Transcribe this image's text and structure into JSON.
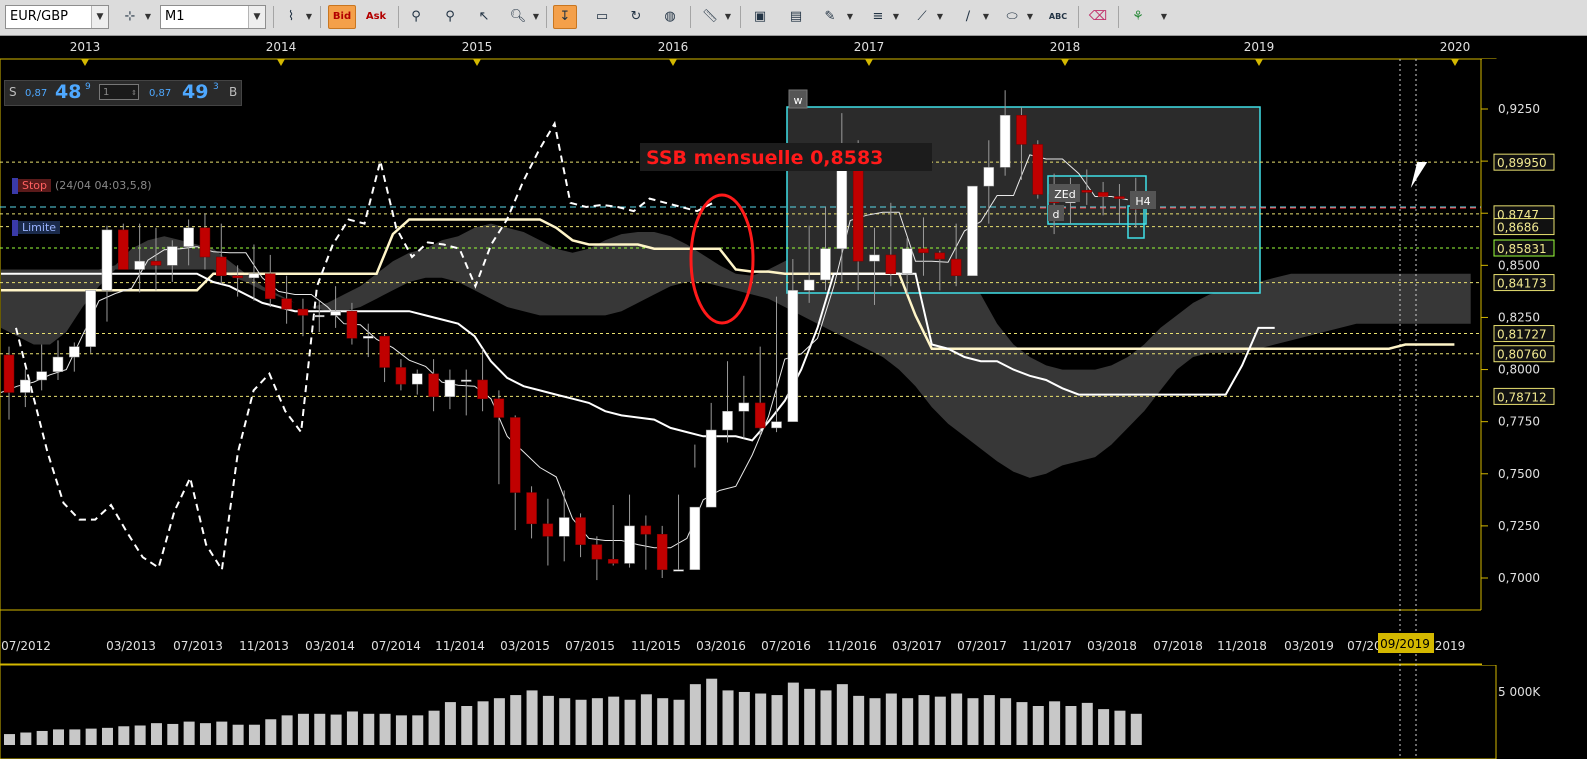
{
  "toolbar": {
    "symbol": "EUR/GBP",
    "timeframe": "M1",
    "bid_label": "Bid",
    "ask_label": "Ask"
  },
  "quote": {
    "sell_label": "S",
    "sell_prefix": "0,87",
    "sell_big": "48",
    "sell_sup": "9",
    "qty": "1",
    "buy_prefix": "0,87",
    "buy_big": "49",
    "buy_sup": "3",
    "buy_label": "B"
  },
  "orders": {
    "stop_label": "Stop",
    "stop_info": "(24/04 04:03,5,8)",
    "limit_label": "Limite"
  },
  "annotation": {
    "title": "SSB mensuelle 0,8583",
    "label_w": "w",
    "label_zed": "ZEd",
    "label_d": "d",
    "label_h4": "H4"
  },
  "axes": {
    "years": [
      "2013",
      "2014",
      "2015",
      "2016",
      "2017",
      "2018",
      "2019",
      "2020"
    ],
    "months": [
      "07/2012",
      "03/2013",
      "07/2013",
      "11/2013",
      "03/2014",
      "07/2014",
      "11/2014",
      "03/2015",
      "07/2015",
      "11/2015",
      "03/2016",
      "07/2016",
      "11/2016",
      "03/2017",
      "07/2017",
      "11/2017",
      "03/2018",
      "07/2018",
      "11/2018",
      "03/2019",
      "07/2019",
      "09/2019",
      "2019"
    ],
    "price_ticks": [
      "0,9250",
      "0,9000",
      "0,8750",
      "0,8500",
      "0,8250",
      "0,8000",
      "0,7750",
      "0,7500",
      "0,7250",
      "0,7000"
    ],
    "level_labels": [
      "0,89950",
      "0,8747",
      "0,8686",
      "0,85831",
      "0,84173",
      "0,81727",
      "0,80760",
      "0,78712"
    ],
    "volume_tick": "5 000K"
  },
  "chart_data": {
    "type": "candlestick",
    "symbol": "EUR/GBP",
    "timeframe": "M1",
    "months": [
      "2012-07",
      "2012-08",
      "2012-09",
      "2012-10",
      "2012-11",
      "2012-12",
      "2013-01",
      "2013-02",
      "2013-03",
      "2013-04",
      "2013-05",
      "2013-06",
      "2013-07",
      "2013-08",
      "2013-09",
      "2013-10",
      "2013-11",
      "2013-12",
      "2014-01",
      "2014-02",
      "2014-03",
      "2014-04",
      "2014-05",
      "2014-06",
      "2014-07",
      "2014-08",
      "2014-09",
      "2014-10",
      "2014-11",
      "2014-12",
      "2015-01",
      "2015-02",
      "2015-03",
      "2015-04",
      "2015-05",
      "2015-06",
      "2015-07",
      "2015-08",
      "2015-09",
      "2015-10",
      "2015-11",
      "2015-12",
      "2016-01",
      "2016-02",
      "2016-03",
      "2016-04",
      "2016-05",
      "2016-06",
      "2016-07",
      "2016-08",
      "2016-09",
      "2016-10",
      "2016-11",
      "2016-12",
      "2017-01",
      "2017-02",
      "2017-03",
      "2017-04",
      "2017-05",
      "2017-06",
      "2017-07",
      "2017-08",
      "2017-09",
      "2017-10",
      "2017-11",
      "2017-12",
      "2018-01",
      "2018-02",
      "2018-03",
      "2018-04"
    ],
    "open": [
      0.807,
      0.789,
      0.795,
      0.799,
      0.806,
      0.811,
      0.838,
      0.867,
      0.848,
      0.852,
      0.85,
      0.859,
      0.868,
      0.854,
      0.845,
      0.844,
      0.846,
      0.834,
      0.829,
      0.826,
      0.826,
      0.828,
      0.815,
      0.816,
      0.801,
      0.793,
      0.798,
      0.787,
      0.795,
      0.795,
      0.786,
      0.777,
      0.741,
      0.726,
      0.72,
      0.729,
      0.716,
      0.709,
      0.707,
      0.725,
      0.721,
      0.704,
      0.704,
      0.734,
      0.771,
      0.78,
      0.784,
      0.772,
      0.775,
      0.838,
      0.843,
      0.858,
      0.905,
      0.852,
      0.855,
      0.846,
      0.858,
      0.856,
      0.853,
      0.845,
      0.888,
      0.897,
      0.922,
      0.908,
      0.884,
      0.88,
      0.886,
      0.885,
      0.883,
      0.882
    ],
    "high": [
      0.811,
      0.8,
      0.812,
      0.814,
      0.813,
      0.822,
      0.869,
      0.87,
      0.87,
      0.868,
      0.862,
      0.872,
      0.875,
      0.87,
      0.85,
      0.86,
      0.855,
      0.845,
      0.834,
      0.833,
      0.84,
      0.832,
      0.822,
      0.817,
      0.805,
      0.8,
      0.805,
      0.8,
      0.8,
      0.81,
      0.79,
      0.778,
      0.744,
      0.738,
      0.742,
      0.731,
      0.72,
      0.735,
      0.74,
      0.73,
      0.725,
      0.74,
      0.764,
      0.784,
      0.804,
      0.797,
      0.811,
      0.835,
      0.853,
      0.869,
      0.878,
      0.923,
      0.91,
      0.868,
      0.88,
      0.863,
      0.873,
      0.857,
      0.87,
      0.887,
      0.91,
      0.934,
      0.926,
      0.91,
      0.894,
      0.892,
      0.896,
      0.89,
      0.889,
      0.892
    ],
    "low": [
      0.776,
      0.782,
      0.79,
      0.795,
      0.799,
      0.808,
      0.823,
      0.85,
      0.837,
      0.838,
      0.842,
      0.85,
      0.848,
      0.841,
      0.835,
      0.833,
      0.83,
      0.822,
      0.816,
      0.818,
      0.82,
      0.812,
      0.806,
      0.794,
      0.79,
      0.788,
      0.78,
      0.781,
      0.778,
      0.78,
      0.745,
      0.723,
      0.719,
      0.706,
      0.708,
      0.71,
      0.699,
      0.706,
      0.705,
      0.704,
      0.7,
      0.704,
      0.753,
      0.765,
      0.765,
      0.767,
      0.768,
      0.77,
      0.826,
      0.832,
      0.838,
      0.842,
      0.838,
      0.831,
      0.84,
      0.836,
      0.845,
      0.838,
      0.84,
      0.86,
      0.87,
      0.893,
      0.891,
      0.882,
      0.865,
      0.87,
      0.879,
      0.874,
      0.87,
      0.868
    ],
    "close": [
      0.789,
      0.795,
      0.799,
      0.806,
      0.811,
      0.838,
      0.867,
      0.848,
      0.852,
      0.85,
      0.859,
      0.868,
      0.854,
      0.845,
      0.844,
      0.846,
      0.834,
      0.829,
      0.826,
      0.826,
      0.828,
      0.815,
      0.816,
      0.801,
      0.793,
      0.798,
      0.787,
      0.795,
      0.795,
      0.786,
      0.777,
      0.741,
      0.726,
      0.72,
      0.729,
      0.716,
      0.709,
      0.707,
      0.725,
      0.721,
      0.704,
      0.704,
      0.734,
      0.771,
      0.78,
      0.784,
      0.772,
      0.775,
      0.838,
      0.843,
      0.858,
      0.905,
      0.852,
      0.855,
      0.846,
      0.858,
      0.856,
      0.853,
      0.845,
      0.888,
      0.897,
      0.922,
      0.908,
      0.884,
      0.88,
      0.886,
      0.885,
      0.883,
      0.882,
      0.877
    ],
    "volume": [
      14,
      16,
      18,
      20,
      20,
      21,
      22,
      24,
      25,
      28,
      27,
      30,
      28,
      30,
      26,
      26,
      33,
      38,
      40,
      40,
      39,
      43,
      40,
      40,
      38,
      38,
      44,
      55,
      50,
      56,
      60,
      64,
      70,
      63,
      60,
      58,
      60,
      62,
      58,
      65,
      60,
      58,
      78,
      85,
      70,
      68,
      66,
      64,
      80,
      72,
      70,
      78,
      63,
      60,
      66,
      60,
      64,
      62,
      66,
      60,
      64,
      60,
      55,
      50,
      56,
      50,
      54,
      46,
      44,
      40
    ],
    "ylim": [
      0.69,
      0.935
    ],
    "levels": [
      0.8995,
      0.8747,
      0.8686,
      0.85831,
      0.84173,
      0.81727,
      0.8076,
      0.78712
    ],
    "ssb_monthly": 0.8583
  },
  "colors": {
    "bull": "#ffffff",
    "bear": "#c00000",
    "cloud": "#3a3a3a",
    "axis_line": "#d4b800",
    "level_yellow": "#e8e070",
    "cyan": "#40e0e8",
    "annotation_red": "#ff1a1a"
  },
  "icons": [
    "chart-type-icon",
    "crosshair-icon",
    "magnifier-icon",
    "cursor-icon",
    "zoom-icon",
    "highlight-icon",
    "screenshot-icon",
    "refresh-icon",
    "globe-icon",
    "ruler-icon",
    "image-icon",
    "panel-icon",
    "draw-tools-icon",
    "lines-icon",
    "fib-icon",
    "pen-icon",
    "ellipse-icon",
    "abc-text-icon",
    "eraser-icon",
    "tree-icon"
  ]
}
